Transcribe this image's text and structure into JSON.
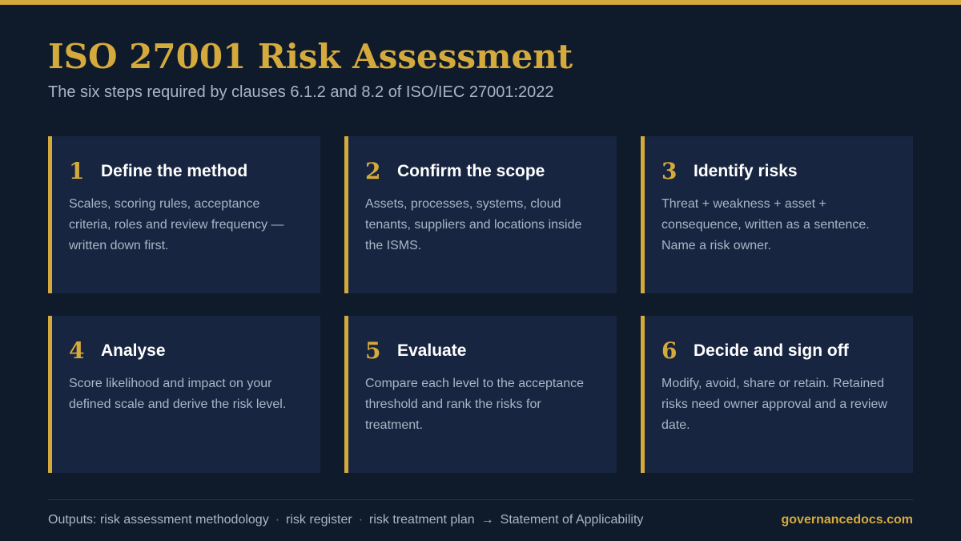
{
  "header": {
    "title": "ISO 27001 Risk Assessment",
    "subtitle": "The six steps required by clauses 6.1.2 and 8.2 of ISO/IEC 27001:2022"
  },
  "steps": [
    {
      "number": "1",
      "title": "Define the method",
      "description": "Scales, scoring rules, acceptance criteria, roles and review frequency — written down first."
    },
    {
      "number": "2",
      "title": "Confirm the scope",
      "description": "Assets, processes, systems, cloud tenants, suppliers and locations inside the ISMS."
    },
    {
      "number": "3",
      "title": "Identify risks",
      "description": "Threat + weakness + asset + consequence, written as a sentence. Name a risk owner."
    },
    {
      "number": "4",
      "title": "Analyse",
      "description": "Score likelihood and impact on your defined scale and derive the risk level."
    },
    {
      "number": "5",
      "title": "Evaluate",
      "description": "Compare each level to the acceptance threshold and rank the risks for treatment."
    },
    {
      "number": "6",
      "title": "Decide and sign off",
      "description": "Modify, avoid, share or retain. Retained risks need owner approval and a review date."
    }
  ],
  "footer": {
    "outputs_label": "Outputs:",
    "outputs": [
      "risk assessment methodology",
      "risk register",
      "risk treatment plan"
    ],
    "separator": "·",
    "arrow": "→",
    "final_output": "Statement of Applicability",
    "brand": "governancedocs.com"
  },
  "colors": {
    "background": "#0f1a2b",
    "card": "#172540",
    "accent": "#d4aa3c",
    "text_muted": "#aab5c5",
    "text_bright": "#ffffff"
  }
}
